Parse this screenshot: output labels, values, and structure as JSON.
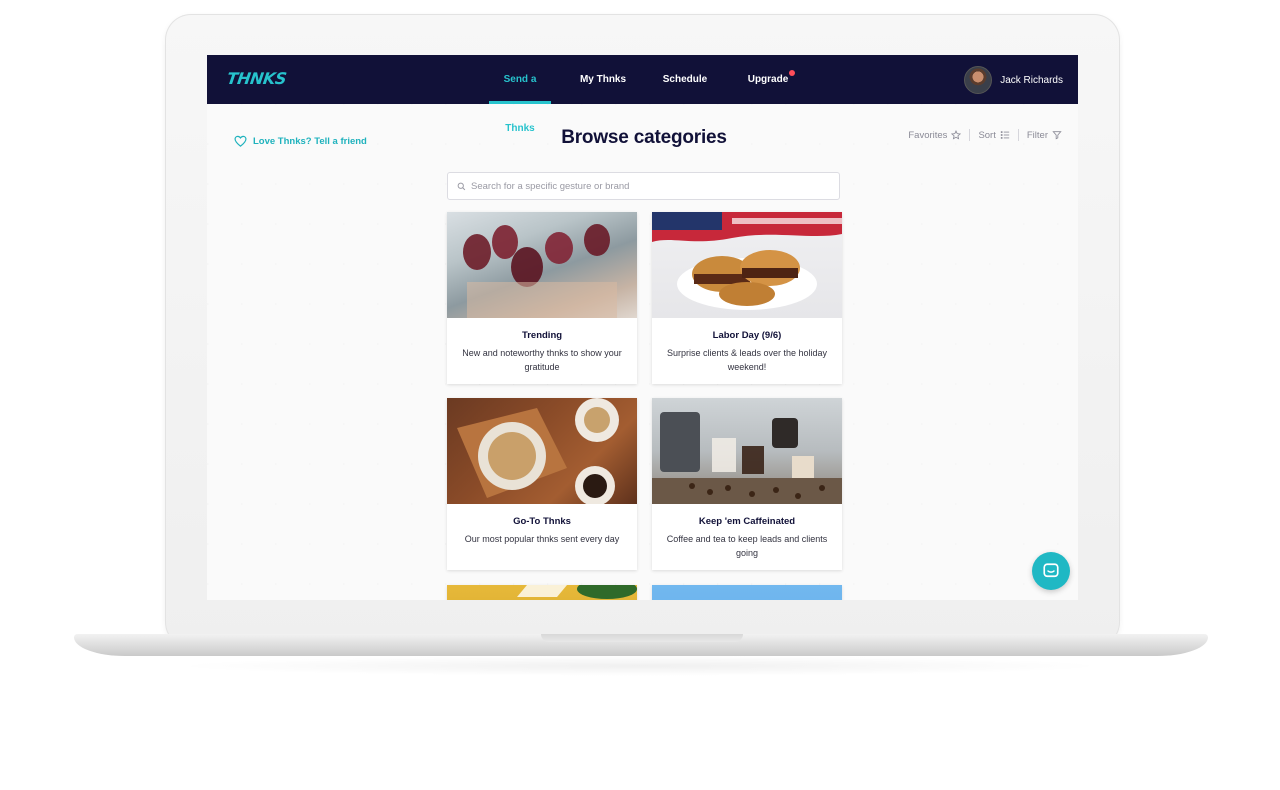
{
  "brand": {
    "logo_text": "THNKS",
    "accent_color": "#27c3cd",
    "nav_bg": "#111138"
  },
  "nav": {
    "items": [
      {
        "label": "Send a Thnks",
        "active": true
      },
      {
        "label": "My Thnks",
        "active": false
      },
      {
        "label": "Schedule",
        "active": false
      },
      {
        "label": "Upgrade",
        "active": false,
        "notification_dot": true
      }
    ],
    "user": {
      "name": "Jack Richards",
      "avatar_icon": "user-avatar"
    }
  },
  "header": {
    "love_link": "Love Thnks? Tell a friend",
    "title": "Browse categories",
    "tools": {
      "favorites": "Favorites",
      "sort": "Sort",
      "filter": "Filter"
    }
  },
  "search": {
    "placeholder": "Search for a specific gesture or brand",
    "value": ""
  },
  "categories": [
    {
      "title": "Trending",
      "description": "New and noteworthy thnks to show your gratitude",
      "image_icon": "wine-glasses-photo"
    },
    {
      "title": "Labor Day (9/6)",
      "description": "Surprise clients & leads over the holiday weekend!",
      "image_icon": "burgers-flag-photo"
    },
    {
      "title": "Go-To Thnks",
      "description": "Our most popular thnks sent every day",
      "image_icon": "bread-coffee-photo"
    },
    {
      "title": "Keep 'em Caffeinated",
      "description": "Coffee and tea to keep leads and clients going",
      "image_icon": "coffee-pour-photo"
    },
    {
      "title": "",
      "description": "",
      "image_icon": "partial-photo-yellow"
    },
    {
      "title": "",
      "description": "",
      "image_icon": "partial-photo-blue"
    }
  ],
  "chat": {
    "icon": "chat-bubble-icon"
  }
}
